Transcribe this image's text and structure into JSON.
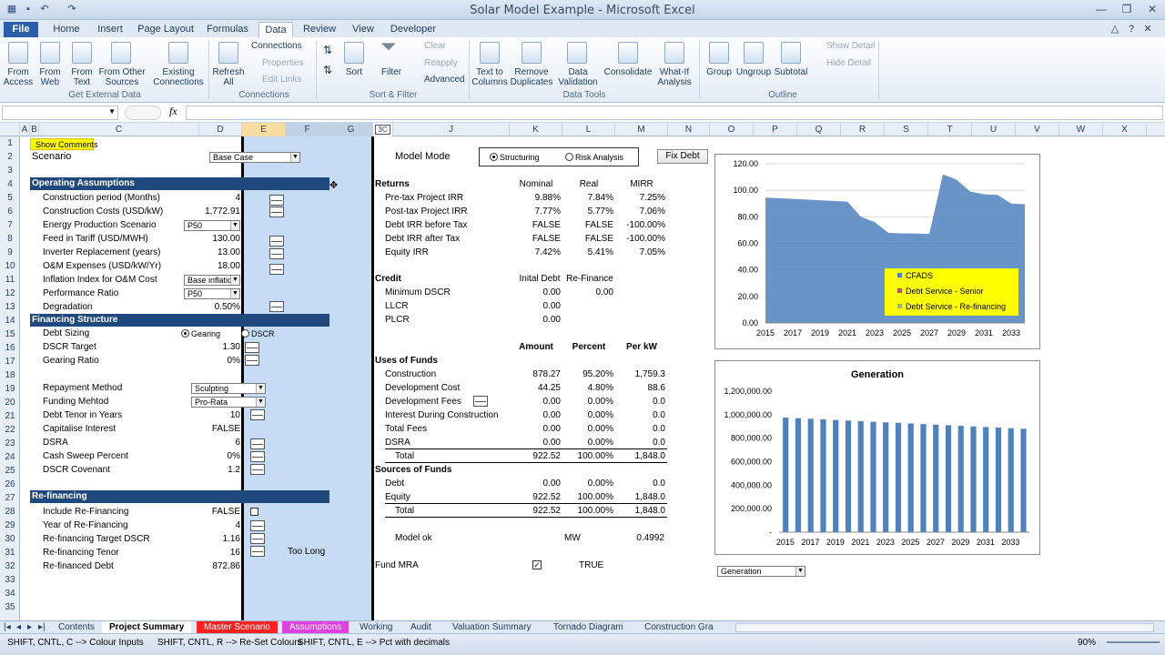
{
  "window": {
    "title": "Solar Model Example - Microsoft Excel"
  },
  "ribbon": {
    "tabs": [
      "File",
      "Home",
      "Insert",
      "Page Layout",
      "Formulas",
      "Data",
      "Review",
      "View",
      "Developer"
    ],
    "get_external": {
      "access": "From\nAccess",
      "web": "From\nWeb",
      "text": "From\nText",
      "other": "From Other\nSources",
      "existing": "Existing\nConnections",
      "group": "Get External Data"
    },
    "connections": {
      "refresh": "Refresh\nAll",
      "connections": "Connections",
      "properties": "Properties",
      "edit_links": "Edit Links",
      "group": "Connections"
    },
    "sort_filter": {
      "sort": "Sort",
      "filter": "Filter",
      "clear": "Clear",
      "reapply": "Reapply",
      "advanced": "Advanced",
      "group": "Sort & Filter"
    },
    "data_tools": {
      "text_to_columns": "Text to\nColumns",
      "remove_dup": "Remove\nDuplicates",
      "validation": "Data\nValidation",
      "consolidate": "Consolidate",
      "whatif": "What-If\nAnalysis",
      "group": "Data Tools"
    },
    "outline": {
      "group_btn": "Group",
      "ungroup": "Ungroup",
      "subtotal": "Subtotal",
      "show_detail": "Show Detail",
      "hide_detail": "Hide Detail",
      "group": "Outline"
    }
  },
  "formula_bar": {
    "fx": "fx",
    "value": ""
  },
  "columns": [
    "A",
    "B",
    "C",
    "D",
    "E",
    "F",
    "G",
    "",
    "J",
    "K",
    "L",
    "M",
    "N",
    "O",
    "P",
    "Q",
    "R",
    "S",
    "T",
    "U",
    "V",
    "W",
    "X"
  ],
  "left": {
    "show_comments": "Show Comments",
    "scenario_label": "Scenario",
    "scenario_value": "Base Case",
    "op_header": "Operating Assumptions",
    "rows": [
      {
        "label": "Construction period (Months)",
        "value": "4"
      },
      {
        "label": "Construction Costs (USD/kW)",
        "value": "1,772.91"
      },
      {
        "label": "Energy Production Scenario",
        "value": "P50"
      },
      {
        "label": "Feed in Tariff (USD/MWH)",
        "value": "130.00"
      },
      {
        "label": "Inverter Replacement (years)",
        "value": "13.00"
      },
      {
        "label": "O&M Expenses (USD/kW/Yr)",
        "value": "18.00"
      },
      {
        "label": "Inflation Index for O&M Cost",
        "value": "Base inflation"
      },
      {
        "label": "Performance Ratio",
        "value": "P50"
      },
      {
        "label": "Degradation",
        "value": "0.50%"
      }
    ],
    "fin_header": "Financing Structure",
    "debt_sizing": "Debt Sizing",
    "gearing": "Gearing",
    "dscr": "DSCR",
    "fin_rows": [
      {
        "label": "DSCR Target",
        "value": "1.30"
      },
      {
        "label": "Gearing Ratio",
        "value": "0%"
      },
      {
        "label": "Repayment Method",
        "value": "Sculpting"
      },
      {
        "label": "Funding Mehtod",
        "value": "Pro-Rata"
      },
      {
        "label": "Debt Tenor in Years",
        "value": "10"
      },
      {
        "label": "Capitalise Interest",
        "value": "FALSE"
      },
      {
        "label": "DSRA",
        "value": "6"
      },
      {
        "label": "Cash Sweep Percent",
        "value": "0%"
      },
      {
        "label": "DSCR Covenant",
        "value": "1.2"
      }
    ],
    "refi_header": "Re-financing",
    "refi_rows": [
      {
        "label": "Include Re-Financing",
        "value": "FALSE"
      },
      {
        "label": "Year of Re-Financing",
        "value": "4"
      },
      {
        "label": "Re-financing Target DSCR",
        "value": "1.16"
      },
      {
        "label": "Re-financing Tenor",
        "value": "16"
      },
      {
        "label": "Re-financed Debt",
        "value": "872.86"
      }
    ],
    "too_long": "Too Long"
  },
  "mid": {
    "model_mode": "Model Mode",
    "structuring": "Structuring",
    "risk": "Risk Analysis",
    "fix_debt": "Fix Debt",
    "returns": "Returns",
    "h_nominal": "Nominal",
    "h_real": "Real",
    "h_mirr": "MIRR",
    "ret_rows": [
      {
        "label": "Pre-tax Project IRR",
        "n": "9.88%",
        "r": "7.84%",
        "m": "7.25%"
      },
      {
        "label": "Post-tax Project IRR",
        "n": "7.77%",
        "r": "5.77%",
        "m": "7.06%"
      },
      {
        "label": "Debt IRR before Tax",
        "n": "FALSE",
        "r": "FALSE",
        "m": "-100.00%"
      },
      {
        "label": "Debt IRR after Tax",
        "n": "FALSE",
        "r": "FALSE",
        "m": "-100.00%"
      },
      {
        "label": "Equity IRR",
        "n": "7.42%",
        "r": "5.41%",
        "m": "7.05%"
      }
    ],
    "credit": "Credit",
    "h_initial": "Inital Debt",
    "h_refi": "Re-Finance",
    "credit_rows": [
      {
        "label": "Minimum DSCR",
        "a": "0.00",
        "b": "0.00"
      },
      {
        "label": "LLCR",
        "a": "0.00",
        "b": ""
      },
      {
        "label": "PLCR",
        "a": "0.00",
        "b": ""
      }
    ],
    "h_amount": "Amount",
    "h_percent": "Percent",
    "h_perkw": "Per kW",
    "uses": "Uses of Funds",
    "uses_rows": [
      {
        "label": "Construction",
        "a": "878.27",
        "p": "95.20%",
        "k": "1,759.3"
      },
      {
        "label": "Development Cost",
        "a": "44.25",
        "p": "4.80%",
        "k": "88.6"
      },
      {
        "label": "Development Fees",
        "a": "0.00",
        "p": "0.00%",
        "k": "0.0"
      },
      {
        "label": "Interest During Construction",
        "a": "0.00",
        "p": "0.00%",
        "k": "0.0"
      },
      {
        "label": "Total Fees",
        "a": "0.00",
        "p": "0.00%",
        "k": "0.0"
      },
      {
        "label": "DSRA",
        "a": "0.00",
        "p": "0.00%",
        "k": "0.0"
      },
      {
        "label": "Total",
        "a": "922.52",
        "p": "100.00%",
        "k": "1,848.0"
      }
    ],
    "sources": "Sources of Funds",
    "src_rows": [
      {
        "label": "Debt",
        "a": "0.00",
        "p": "0.00%",
        "k": "0.0"
      },
      {
        "label": "Equity",
        "a": "922.52",
        "p": "100.00%",
        "k": "1,848.0"
      },
      {
        "label": "Total",
        "a": "922.52",
        "p": "100.00%",
        "k": "1,848.0"
      }
    ],
    "model_ok": "Model ok",
    "mw": "MW",
    "mw_val": "0.4992",
    "fund_mra": "Fund MRA",
    "fund_mra_val": "TRUE"
  },
  "chart_data": [
    {
      "type": "area",
      "x": [
        "2015",
        "2016",
        "2017",
        "2018",
        "2019",
        "2020",
        "2021",
        "2022",
        "2023",
        "2024",
        "2025",
        "2026",
        "2027",
        "2028",
        "2029",
        "2030",
        "2031",
        "2032",
        "2033",
        "2034"
      ],
      "series": [
        {
          "name": "CFADS",
          "values": [
            94.5,
            94,
            93.5,
            93,
            92.5,
            92,
            91.5,
            80,
            76,
            68,
            67.5,
            67.5,
            67,
            112,
            108,
            99,
            97,
            96.5,
            90,
            89.5
          ],
          "color": "#4f81bd"
        },
        {
          "name": "Debt Service - Senior",
          "values": [
            0,
            0,
            0,
            0,
            0,
            0,
            0,
            0,
            0,
            0,
            0,
            0,
            0,
            0,
            0,
            0,
            0,
            0,
            0,
            0
          ],
          "color": "#c0504d"
        },
        {
          "name": "Debt Service - Re-financing",
          "values": [
            0,
            0,
            0,
            0,
            0,
            0,
            0,
            0,
            0,
            0,
            0,
            0,
            0,
            0,
            0,
            0,
            0,
            0,
            0,
            0
          ],
          "color": "#9bbb59"
        }
      ],
      "xticks": [
        "2015",
        "2017",
        "2019",
        "2021",
        "2023",
        "2025",
        "2027",
        "2029",
        "2031",
        "2033"
      ],
      "yticks": [
        "120.00",
        "100.00",
        "80.00",
        "60.00",
        "40.00",
        "20.00",
        "0.00"
      ],
      "ylim": [
        0,
        120
      ],
      "legend": "bottom-right",
      "legend_bg": "#ffff00"
    },
    {
      "type": "bar",
      "title": "Generation",
      "x": [
        "2015",
        "2016",
        "2017",
        "2018",
        "2019",
        "2020",
        "2021",
        "2022",
        "2023",
        "2024",
        "2025",
        "2026",
        "2027",
        "2028",
        "2029",
        "2030",
        "2031",
        "2032",
        "2033",
        "2034"
      ],
      "values": [
        975000,
        970000,
        965000,
        960000,
        955000,
        950000,
        945000,
        940000,
        935000,
        930000,
        925000,
        920000,
        915000,
        910000,
        905000,
        900000,
        895000,
        890000,
        885000,
        880000
      ],
      "xticks": [
        "2015",
        "2017",
        "2019",
        "2021",
        "2023",
        "2025",
        "2027",
        "2029",
        "2031",
        "2033"
      ],
      "yticks": [
        "1,200,000.00",
        "1,000,000.00",
        "800,000.00",
        "600,000.00",
        "400,000.00",
        "200,000.00",
        "-"
      ],
      "ylim": [
        0,
        1200000
      ],
      "color": "#4f81bd"
    }
  ],
  "chart_select": "Generation",
  "sheet_tabs": [
    "Contents",
    "Project Summary",
    "Master Scenario",
    "Assumptions",
    "Working",
    "Audit",
    "Valuation Summary",
    "Tornado Diagram",
    "Construction Gra"
  ],
  "status": {
    "hint1": "SHIFT, CNTL, C --> Colour Inputs",
    "hint2": "SHIFT, CNTL, R --> Re-Set Colours",
    "hint3": "SHIFT, CNTL, E --> Pct with decimals",
    "zoom": "90%"
  }
}
